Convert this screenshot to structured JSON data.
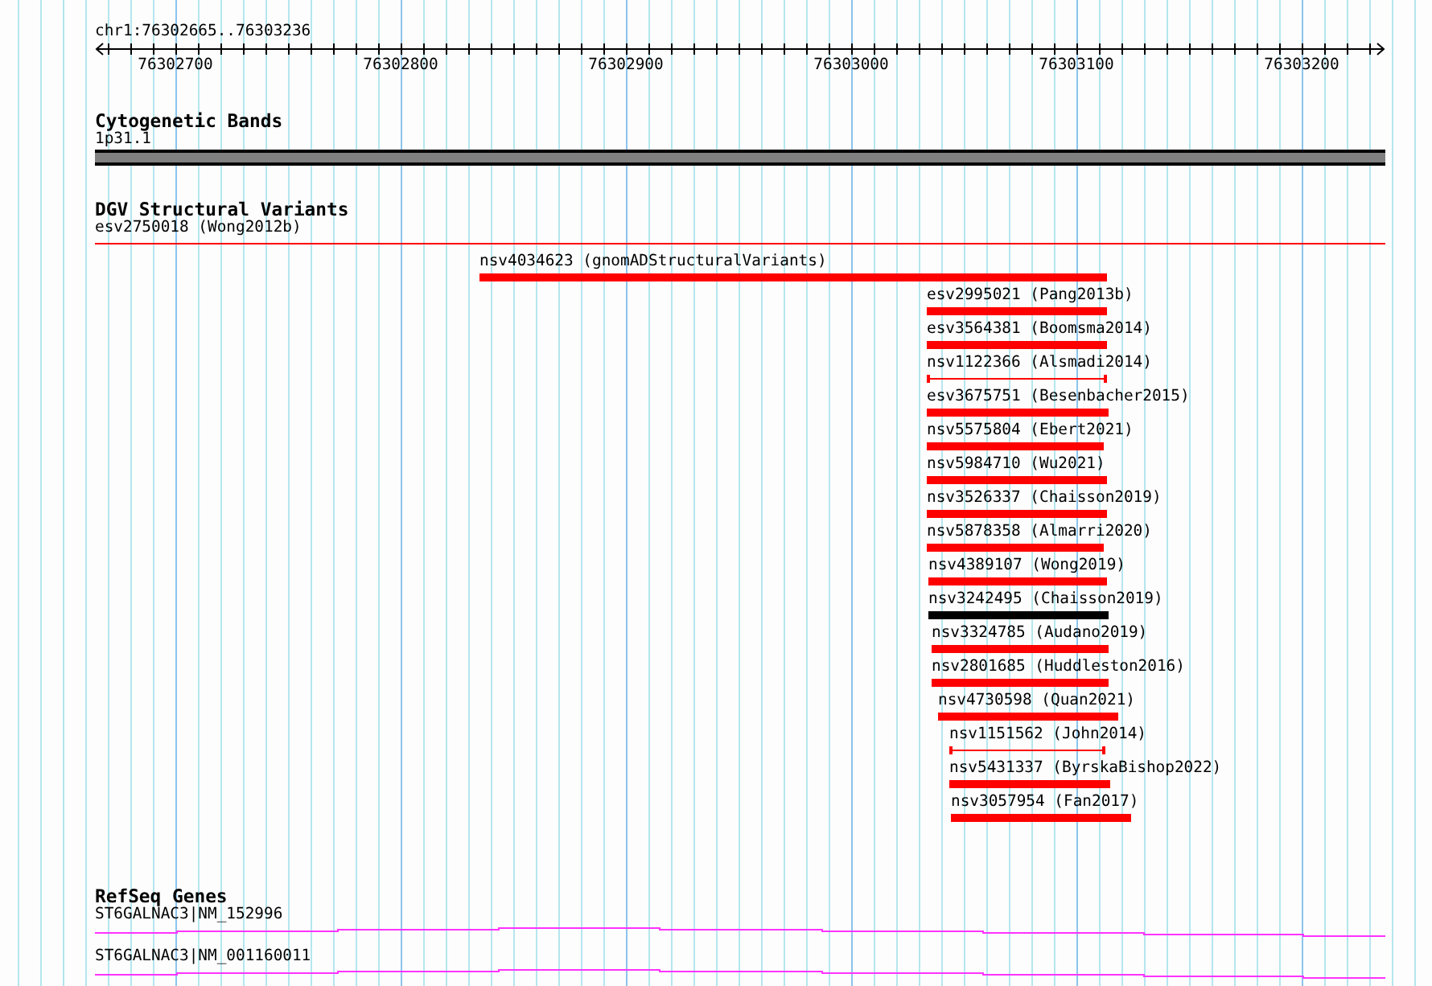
{
  "ruler": {
    "location": "chr1:76302665..76303236",
    "ticks": [
      "76302700",
      "76302800",
      "76302900",
      "76303000",
      "76303100",
      "76303200"
    ]
  },
  "tracks": [
    {
      "kind": "bands",
      "title": "Cytogenetic Bands",
      "label": "1p31.1"
    },
    {
      "kind": "variants",
      "title": "DGV Structural Variants",
      "features": [
        {
          "label": "esv2750018 (Wong2012b)",
          "kind": "line",
          "color": "#ff0000"
        },
        {
          "label": "nsv4034623 (gnomADStructuralVariants)",
          "kind": "bar",
          "color": "#ff0000"
        },
        {
          "label": "esv2995021 (Pang2013b)",
          "kind": "bar",
          "color": "#ff0000"
        },
        {
          "label": "esv3564381 (Boomsma2014)",
          "kind": "bar",
          "color": "#ff0000"
        },
        {
          "label": "nsv1122366 (Alsmadi2014)",
          "kind": "bracket",
          "color": "#ff0000"
        },
        {
          "label": "esv3675751 (Besenbacher2015)",
          "kind": "bar",
          "color": "#ff0000"
        },
        {
          "label": "nsv5575804 (Ebert2021)",
          "kind": "bar",
          "color": "#ff0000"
        },
        {
          "label": "nsv5984710 (Wu2021)",
          "kind": "bar",
          "color": "#ff0000"
        },
        {
          "label": "nsv3526337 (Chaisson2019)",
          "kind": "bar",
          "color": "#ff0000"
        },
        {
          "label": "nsv5878358 (Almarri2020)",
          "kind": "bar",
          "color": "#ff0000"
        },
        {
          "label": "nsv4389107 (Wong2019)",
          "kind": "bar",
          "color": "#ff0000"
        },
        {
          "label": "nsv3242495 (Chaisson2019)",
          "kind": "bar",
          "color": "#000000"
        },
        {
          "label": "nsv3324785 (Audano2019)",
          "kind": "bar",
          "color": "#ff0000"
        },
        {
          "label": "nsv2801685 (Huddleston2016)",
          "kind": "bar",
          "color": "#ff0000"
        },
        {
          "label": "nsv4730598 (Quan2021)",
          "kind": "bar",
          "color": "#ff0000"
        },
        {
          "label": "nsv1151562 (John2014)",
          "kind": "bracket",
          "color": "#ff0000"
        },
        {
          "label": "nsv5431337 (ByrskaBishop2022)",
          "kind": "bar",
          "color": "#ff0000"
        },
        {
          "label": "nsv3057954 (Fan2017)",
          "kind": "bar",
          "color": "#ff0000"
        }
      ]
    },
    {
      "kind": "genes",
      "title": "RefSeq Genes",
      "transcripts": [
        "ST6GALNAC3|NM_152996",
        "ST6GALNAC3|NM_001160011"
      ]
    }
  ]
}
